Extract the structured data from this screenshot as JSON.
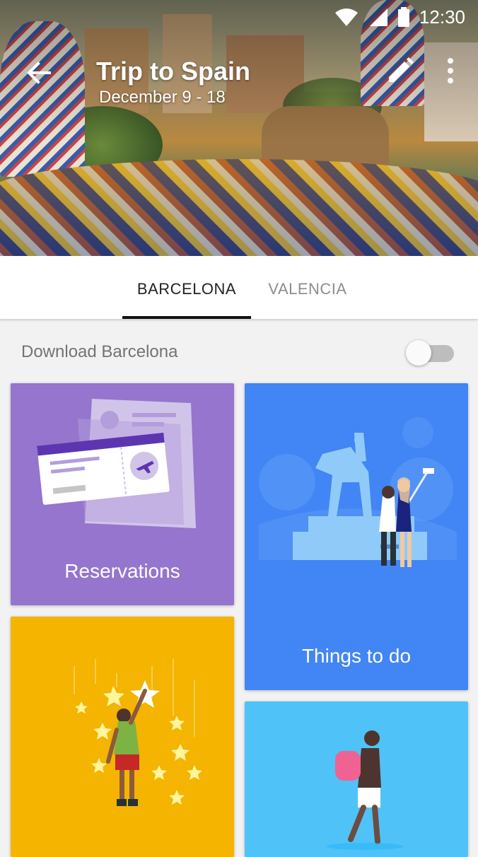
{
  "status_bar": {
    "time": "12:30"
  },
  "app_bar": {
    "title": "Trip to Spain",
    "subtitle": "December 9 - 18"
  },
  "tabs": [
    {
      "label": "BARCELONA",
      "selected": true
    },
    {
      "label": "VALENCIA",
      "selected": false
    }
  ],
  "download": {
    "label": "Download Barcelona",
    "enabled": false
  },
  "cards": [
    {
      "label": "Reservations",
      "color": "#9575cd"
    },
    {
      "label": "Things to do",
      "color": "#4285f4"
    },
    {
      "label": "",
      "color": "#f4b400"
    },
    {
      "label": "",
      "color": "#4fc3f7"
    }
  ],
  "icons": [
    "wifi-icon",
    "cell-signal-icon",
    "battery-icon",
    "back-arrow-icon",
    "edit-pencil-icon",
    "more-vert-icon"
  ]
}
